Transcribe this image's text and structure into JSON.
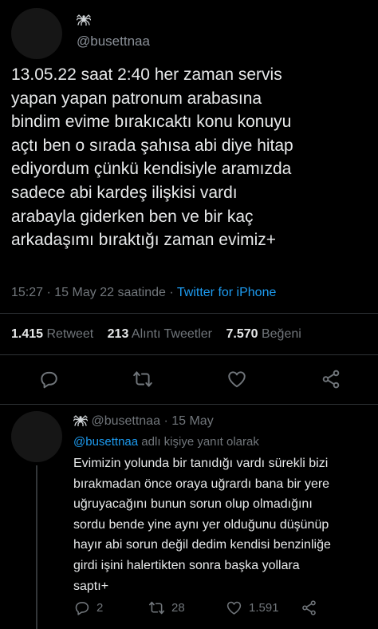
{
  "header": {
    "name_emoji_icon": "spider-icon",
    "handle": "@busettnaa"
  },
  "tweet": {
    "text": "13.05.22 saat 2:40 her zaman servis\nyapan yapan patronum arabasına\nbindim evime bırakıcaktı konu konuyu\naçtı ben o sırada şahısa abi diye hitap\nediyordum çünkü kendisiyle aramızda\nsadece abi kardeş ilişkisi vardı\narabayla giderken ben ve bir kaç\narkadaşımı bıraktığı zaman evimiz+",
    "time": "15:27",
    "date": "15 May 22 saatinde",
    "sep": "·",
    "source": "Twitter for iPhone"
  },
  "stats": {
    "retweets_count": "1.415",
    "retweets_label": "Retweet",
    "quotes_count": "213",
    "quotes_label": "Alıntı Tweetler",
    "likes_count": "7.570",
    "likes_label": "Beğeni"
  },
  "actions": [
    "reply-icon",
    "retweet-icon",
    "like-icon",
    "share-icon"
  ],
  "reply": {
    "handle": "@busettnaa",
    "sep": "·",
    "date": "15 May",
    "replying_mention": "@busettnaa",
    "replying_suffix": "adlı kişiye yanıt olarak",
    "text": "Evimizin yolunda bir tanıdığı vardı sürekli bizi\nbırakmadan önce oraya uğrardı bana bir yere\nuğruyacağını bunun sorun olup olmadığını\nsordu bende yine aynı yer olduğunu düşünüp\nhayır abi sorun değil dedim kendisi benzinliğe\ngirdi işini halertikten sonra başka yollara\nsaptı+",
    "reply_count": "2",
    "retweet_count": "28",
    "like_count": "1.591"
  },
  "colors": {
    "background": "#000000",
    "text": "#e7e9ea",
    "muted": "#71767b",
    "link": "#1d9bf0",
    "divider": "#2f3336"
  }
}
